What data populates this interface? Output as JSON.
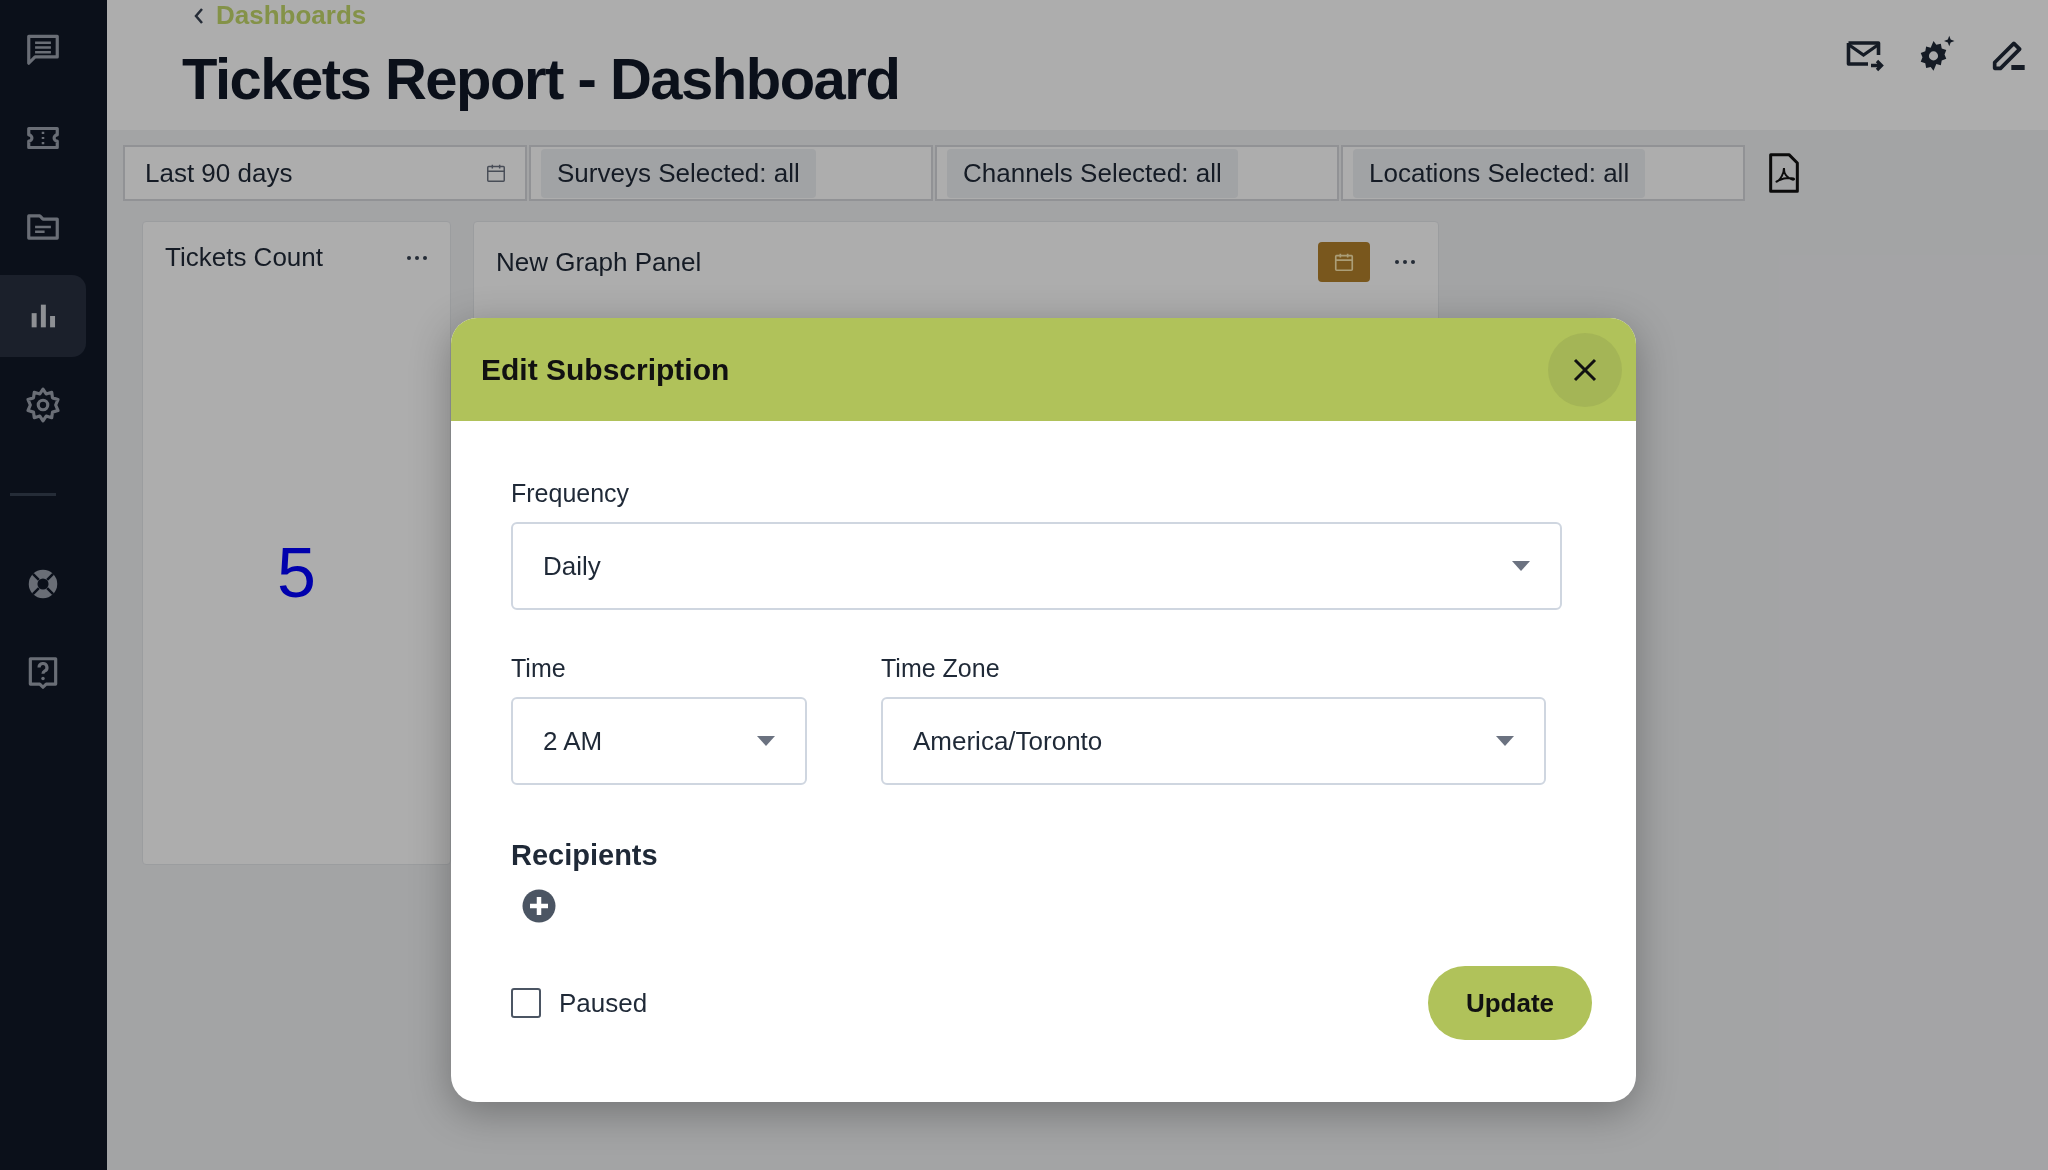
{
  "sidebar": {
    "top_items": [
      {
        "selected": false
      },
      {
        "selected": false
      },
      {
        "selected": false
      },
      {
        "selected": true
      },
      {
        "selected": false
      }
    ],
    "bottom_items": [
      {
        "selected": false
      },
      {
        "selected": false
      }
    ]
  },
  "header": {
    "breadcrumb": "Dashboards",
    "title": "Tickets Report - Dashboard"
  },
  "filters": [
    {
      "kind": "date",
      "value": "Last 90 days"
    },
    {
      "kind": "chip",
      "value": "Surveys Selected: all"
    },
    {
      "kind": "chip",
      "value": "Channels Selected: all"
    },
    {
      "kind": "chip",
      "value": "Locations Selected: all"
    }
  ],
  "panels": [
    {
      "kind": "number",
      "title": "Tickets Count",
      "value": "5"
    },
    {
      "kind": "graph",
      "title": "New Graph Panel"
    }
  ],
  "modal": {
    "title": "Edit Subscription",
    "frequency": {
      "label": "Frequency",
      "value": "Daily"
    },
    "time": {
      "label": "Time",
      "value": "2 AM"
    },
    "time_zone": {
      "label": "Time Zone",
      "value": "America/Toronto"
    },
    "recipients_heading": "Recipients",
    "paused": {
      "label": "Paused",
      "checked": false
    },
    "button": "Update"
  }
}
